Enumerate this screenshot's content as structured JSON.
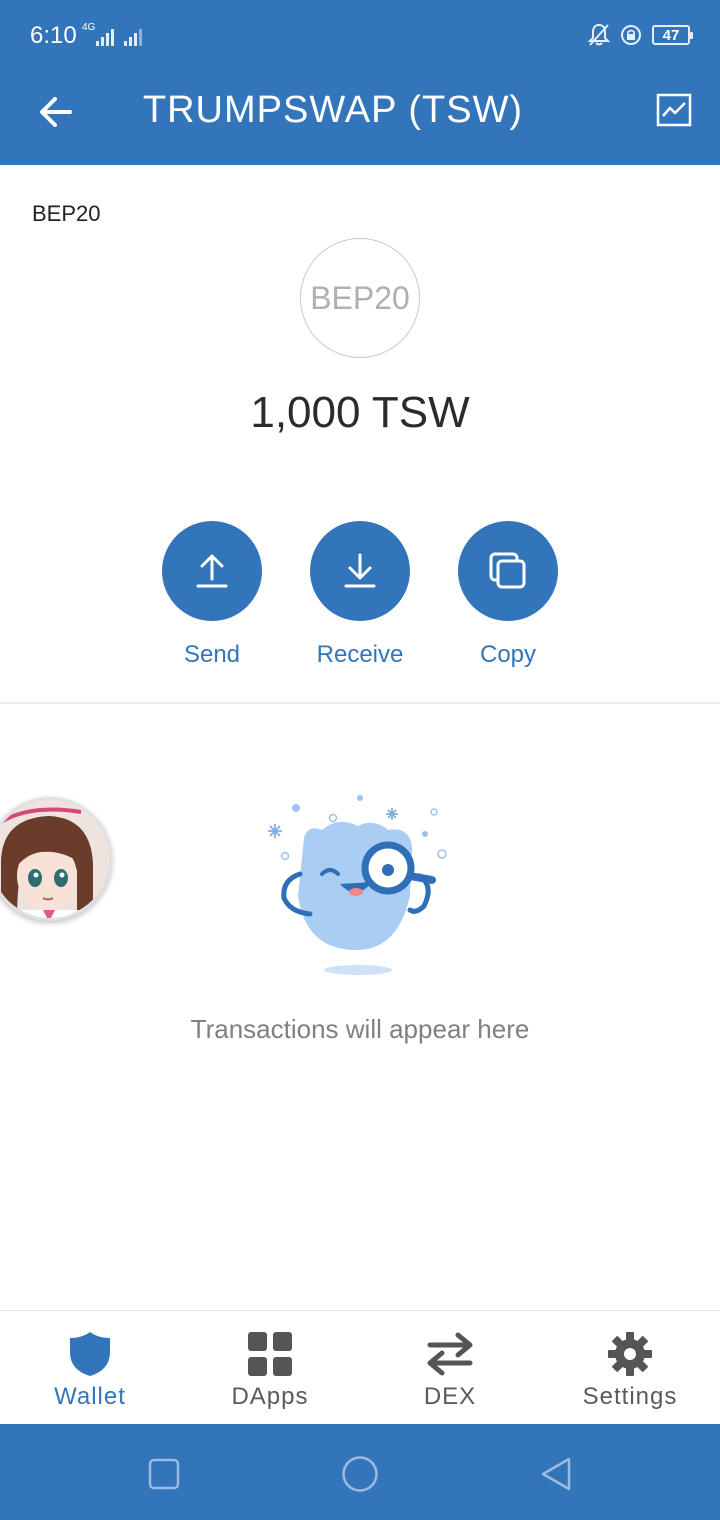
{
  "status_bar": {
    "time": "6:10",
    "network": "4G",
    "battery": "47"
  },
  "header": {
    "title": "TRUMPSWAP (TSW)",
    "back_icon": "arrow-left-icon",
    "chart_icon": "chart-line-icon"
  },
  "token": {
    "type_label": "BEP20",
    "logo_text": "BEP20",
    "balance": "1,000 TSW"
  },
  "actions": [
    {
      "label": "Send",
      "icon": "upload-arrow-icon"
    },
    {
      "label": "Receive",
      "icon": "download-arrow-icon"
    },
    {
      "label": "Copy",
      "icon": "copy-icon"
    }
  ],
  "empty_state": {
    "message": "Transactions will appear here"
  },
  "bottom_nav": [
    {
      "label": "Wallet",
      "icon": "shield-icon",
      "active": true
    },
    {
      "label": "DApps",
      "icon": "grid-icon",
      "active": false
    },
    {
      "label": "DEX",
      "icon": "swap-arrows-icon",
      "active": false
    },
    {
      "label": "Settings",
      "icon": "gear-icon",
      "active": false
    }
  ],
  "colors": {
    "brand_blue": "#3375bb",
    "label_gray": "#808080"
  }
}
